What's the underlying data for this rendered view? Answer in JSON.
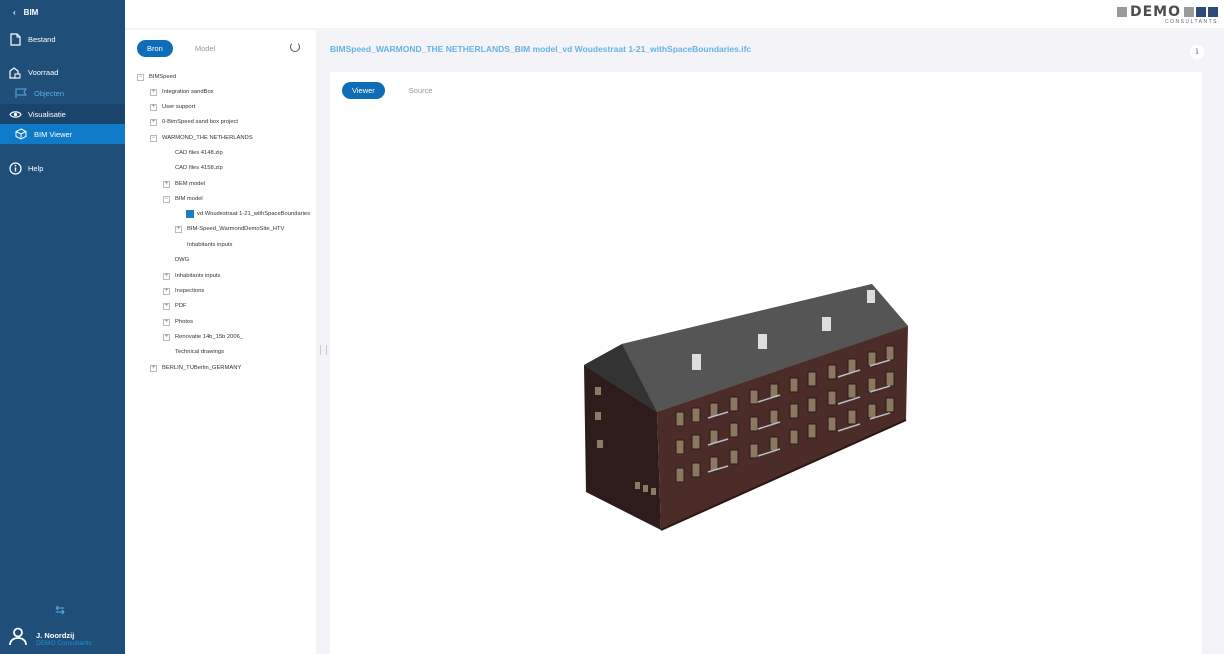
{
  "sidebar": {
    "back_label": "BIM",
    "items": [
      {
        "label": "Bestand",
        "icon": "file-icon"
      },
      {
        "label": "Voorraad",
        "icon": "building-icon"
      },
      {
        "label": "Objecten",
        "icon": "flag-icon"
      },
      {
        "label": "Visualisatie",
        "icon": "eye-icon"
      },
      {
        "label": "BIM Viewer",
        "icon": "cube-icon"
      },
      {
        "label": "Help",
        "icon": "info-icon"
      }
    ],
    "user": {
      "name": "J. Noordzij",
      "org": "DEMO Consultants"
    }
  },
  "logo": {
    "text": "DEMO",
    "sub": "CONSULTANTS"
  },
  "tree_panel": {
    "tabs": [
      "Bron",
      "Model"
    ],
    "nodes": [
      {
        "label": "BIMSpeed"
      },
      {
        "label": "Integration sandBox"
      },
      {
        "label": "User support"
      },
      {
        "label": "0-BimSpeed sand box project"
      },
      {
        "label": "WARMOND_THE NETHERLANDS"
      },
      {
        "label": "CAD files 4148.zip"
      },
      {
        "label": "CAD files 4158.zip"
      },
      {
        "label": "BEM model"
      },
      {
        "label": "BIM model"
      },
      {
        "label": "vd Woudestraat 1-21_withSpaceBoundaries"
      },
      {
        "label": "BIM-Speed_WarmondDemoSite_HTV"
      },
      {
        "label": "Inhabitants inputs"
      },
      {
        "label": "DWG"
      },
      {
        "label": "Inhabitants inputs"
      },
      {
        "label": "Inspections"
      },
      {
        "label": "PDF"
      },
      {
        "label": "Photos"
      },
      {
        "label": "Renovatie 14b_15b 2006_"
      },
      {
        "label": "Technical drawings"
      },
      {
        "label": "BERLIN_TUBerlin_GERMANY"
      }
    ]
  },
  "main": {
    "title": "BIMSpeed_WARMOND_THE NETHERLANDS_BIM model_vd Woudestraat 1-21_withSpaceBoundaries.ifc",
    "info_label": "i",
    "viewer_tabs": [
      "Viewer",
      "Source"
    ]
  },
  "colors": {
    "sidebar": "#1f4e79",
    "active": "#0f7ac7",
    "accent_text": "#66b3e6"
  }
}
